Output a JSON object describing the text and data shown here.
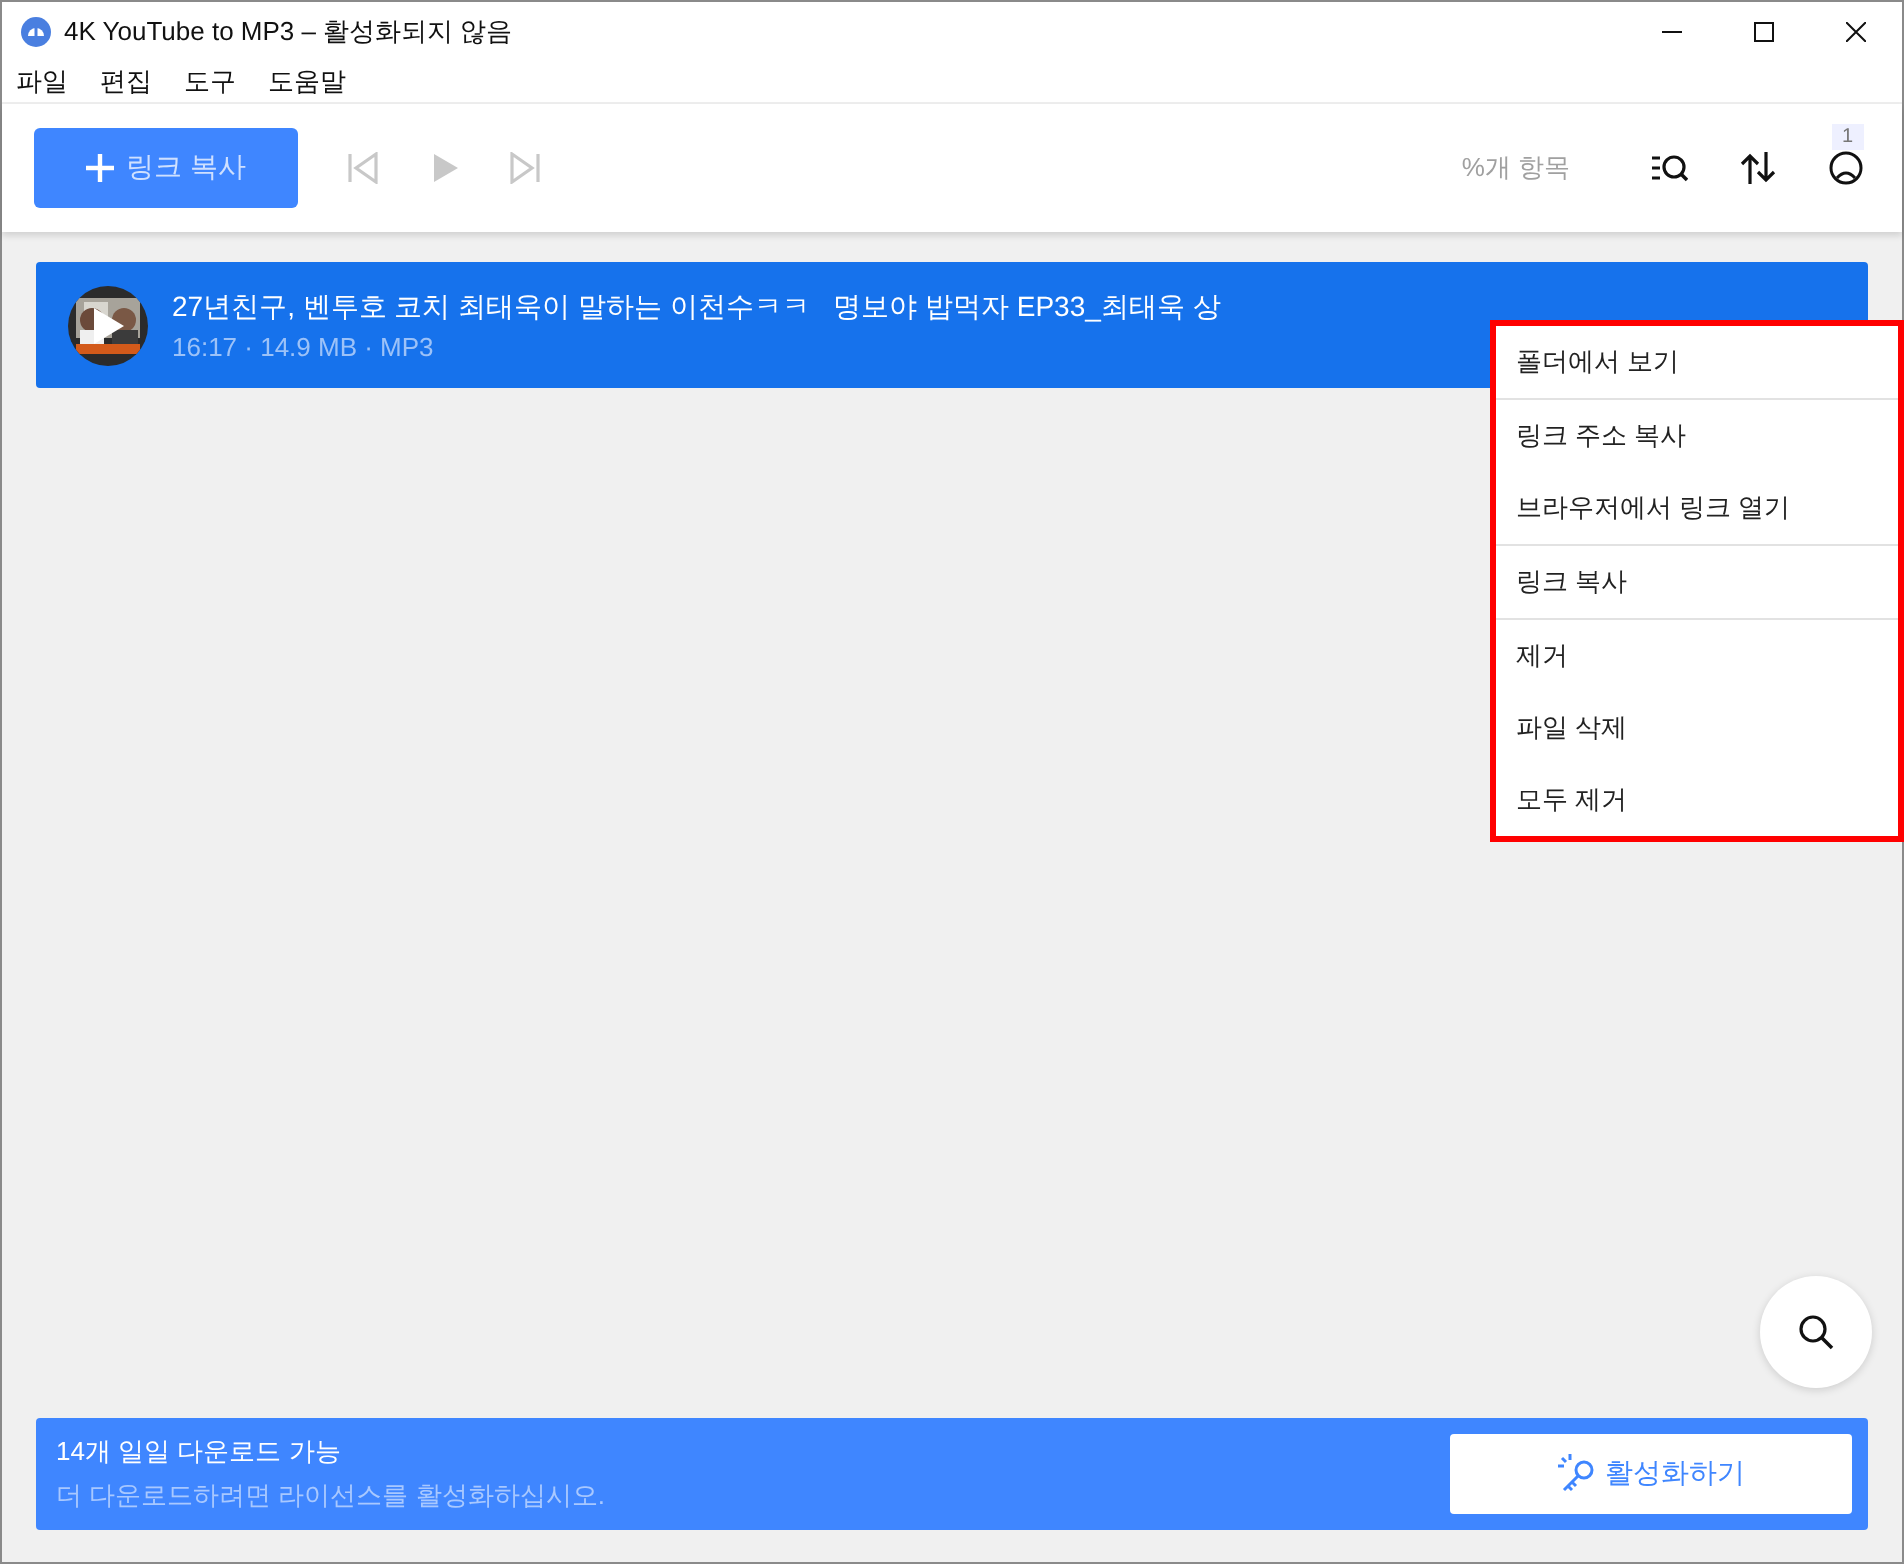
{
  "window": {
    "title": "4K YouTube to MP3 – 활성화되지 않음"
  },
  "menu_bar": [
    "파일",
    "편집",
    "도구",
    "도움말"
  ],
  "toolbar": {
    "add_button": "링크 복사",
    "player": [
      {
        "kind": "previous",
        "disabled": true
      },
      {
        "kind": "play",
        "disabled": true
      },
      {
        "kind": "next",
        "disabled": true
      }
    ],
    "count": "%개 항목",
    "notification_badge": "1"
  },
  "downloads": [
    {
      "title": "27년친구, 벤투호 코치 최태욱이 말하는 이천수ㅋㅋ   명보야 밥먹자 EP33_최태욱 상",
      "info": "16:17 · 14.9 MB · MP3",
      "selected": true
    }
  ],
  "context_menu": {
    "groups": [
      [
        "폴더에서 보기"
      ],
      [
        "링크 주소 복사",
        "브라우저에서 링크 열기"
      ],
      [
        "링크 복사"
      ],
      [
        "제거",
        "파일 삭제",
        "모두 제거"
      ]
    ]
  },
  "banner": {
    "headline": "14개 일일 다운로드 가능",
    "message": "더 다운로드하려면 라이선스를 활성화하십시오.",
    "button": "활성화하기"
  }
}
